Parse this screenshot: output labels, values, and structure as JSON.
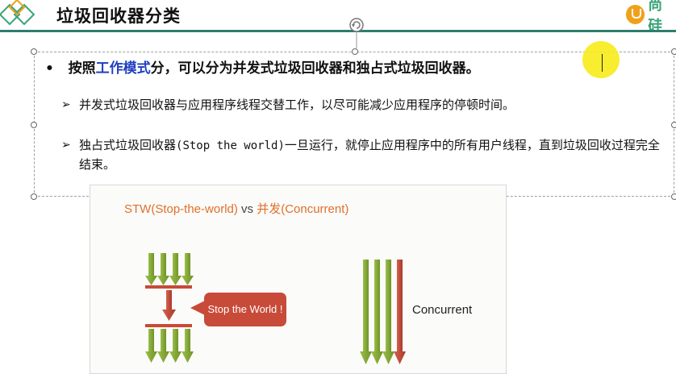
{
  "header": {
    "title": "垃圾回收器分类",
    "logo_text": "尚硅"
  },
  "content": {
    "bullet": {
      "marker": "•",
      "prefix": "按照",
      "highlight": "工作模式",
      "suffix": "分，可以分为并发式垃圾回收器和独占式垃圾回收器。"
    },
    "sub_items": [
      {
        "marker": "➢",
        "text": "并发式垃圾回收器与应用程序线程交替工作，以尽可能减少应用程序的停顿时间。"
      },
      {
        "marker": "➢",
        "text_before": "独占式垃圾回收器",
        "text_mono": "(Stop the world)",
        "text_after": "一旦运行，就停止应用程序中的所有用户线程，直到垃圾回收过程完全结束。"
      }
    ]
  },
  "figure": {
    "title_left": "STW(Stop-the-world)",
    "title_vs": " vs ",
    "title_right": "并发(Concurrent)",
    "stw_label": "Stop the World !",
    "concurrent_label": "Concurrent"
  },
  "colors": {
    "header_rule": "#2e7d6e",
    "highlight_text": "#1f3fbf",
    "green_arrow": "#8aac3a",
    "red_arrow": "#c84a38",
    "cursor": "#f7ec1d",
    "logo": "#3aa37a"
  }
}
